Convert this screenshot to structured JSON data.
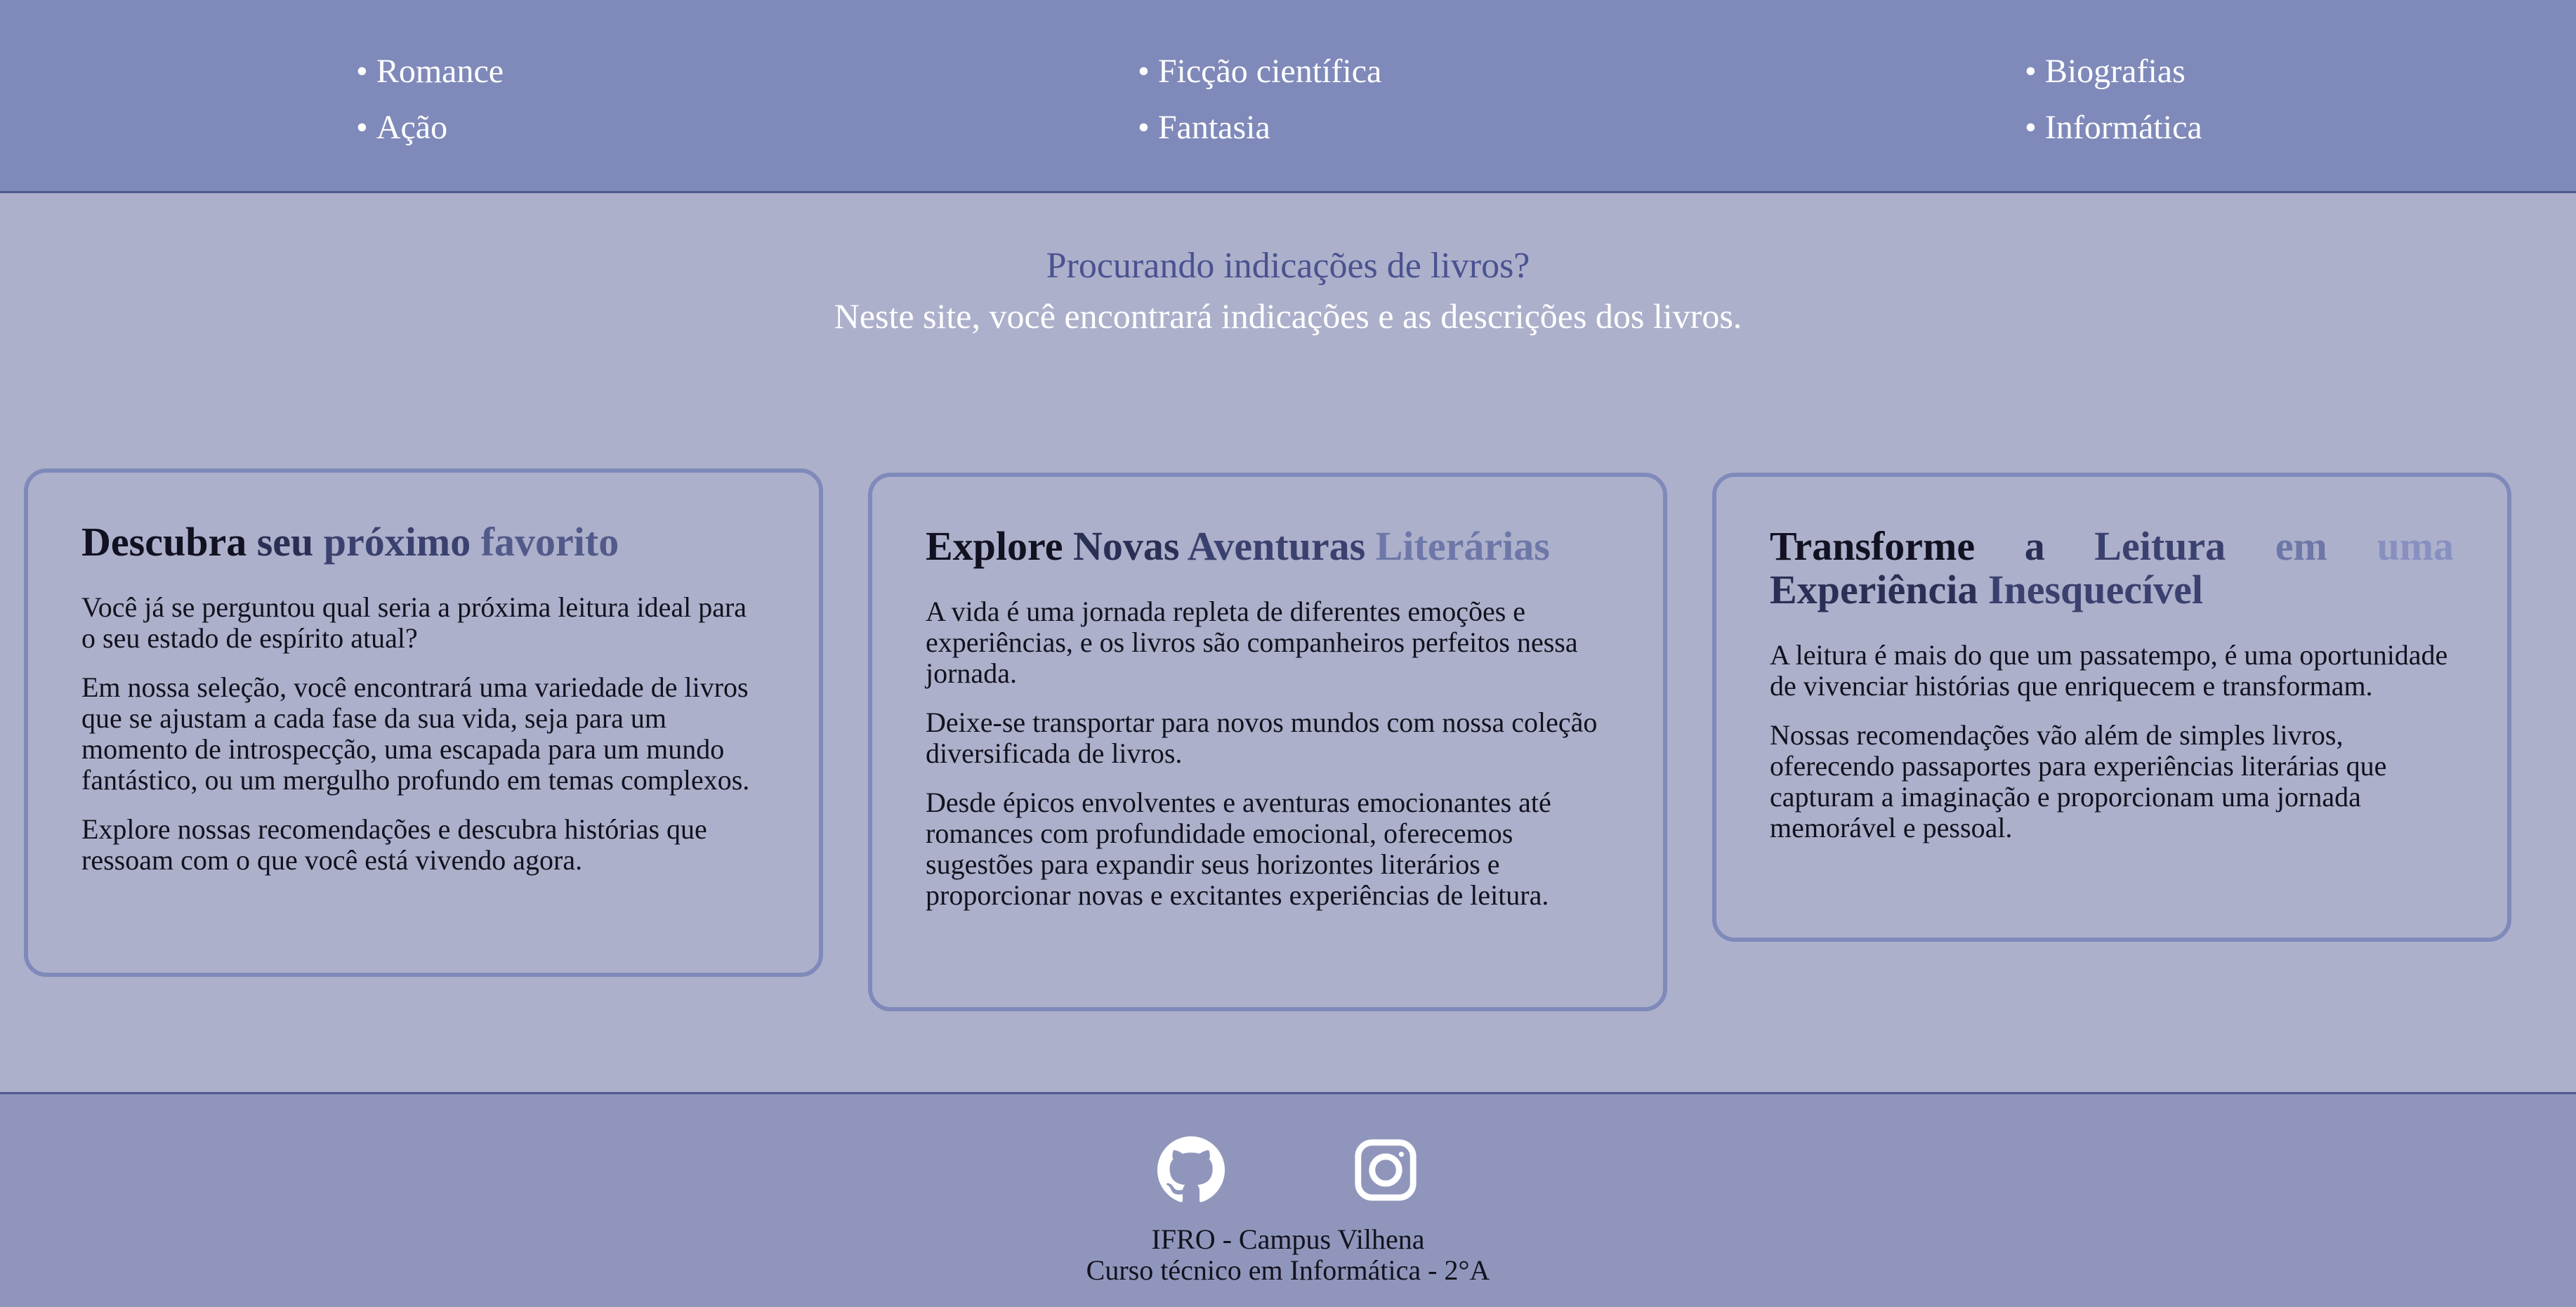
{
  "nav": {
    "col1": [
      "Romance",
      "Ação"
    ],
    "col2": [
      "Ficção científica",
      "Fantasia"
    ],
    "col3": [
      "Biografias",
      "Informática"
    ]
  },
  "hero": {
    "title": "Procurando indicações de livros?",
    "subtitle": "Neste site, você encontrará indicações e as descrições dos livros."
  },
  "cards": [
    {
      "title_words": [
        "Descubra",
        "seu",
        "próximo",
        "favorito"
      ],
      "paragraphs": [
        "Você já se perguntou qual seria a próxima leitura ideal para o seu estado de espírito atual?",
        "Em nossa seleção, você encontrará uma variedade de livros que se ajustam a cada fase da sua vida, seja para um momento de introspecção, uma escapada para um mundo fantástico, ou um mergulho profundo em temas complexos.",
        "Explore nossas recomendações e descubra histórias que ressoam com o que você está vivendo agora."
      ]
    },
    {
      "title_words": [
        "Explore",
        "Novas",
        "Aventuras",
        "Literárias"
      ],
      "paragraphs": [
        "A vida é uma jornada repleta de diferentes emoções e experiências, e os livros são companheiros perfeitos nessa jornada.",
        "Deixe-se transportar para novos mundos com nossa coleção diversificada de livros.",
        "Desde épicos envolventes e aventuras emocionantes até romances com profundidade emocional, oferecemos sugestões para expandir seus horizontes literários e proporcionar novas e excitantes experiências de leitura."
      ]
    },
    {
      "title_words": [
        "Transforme",
        "a",
        "Leitura",
        "em",
        "uma",
        "Experiência",
        "Inesquecível"
      ],
      "paragraphs": [
        "A leitura é mais do que um passatempo, é uma oportunidade de vivenciar histórias que enriquecem e transformam.",
        "Nossas recomendações vão além de simples livros, oferecendo passaportes para experiências literárias que capturam a imaginação e proporcionam uma jornada memorável e pessoal."
      ]
    }
  ],
  "footer": {
    "icons": [
      "github-icon",
      "instagram-icon"
    ],
    "line1": "IFRO - Campus Vilhena",
    "line2": "Curso técnico em Informática - 2°A"
  },
  "colors": {
    "nav_bg": "#7f8aba",
    "page_bg": "#adb0cb",
    "footer_bg": "#9096bb",
    "hero_title": "#4a5290",
    "card_border": "#7f8aba"
  }
}
